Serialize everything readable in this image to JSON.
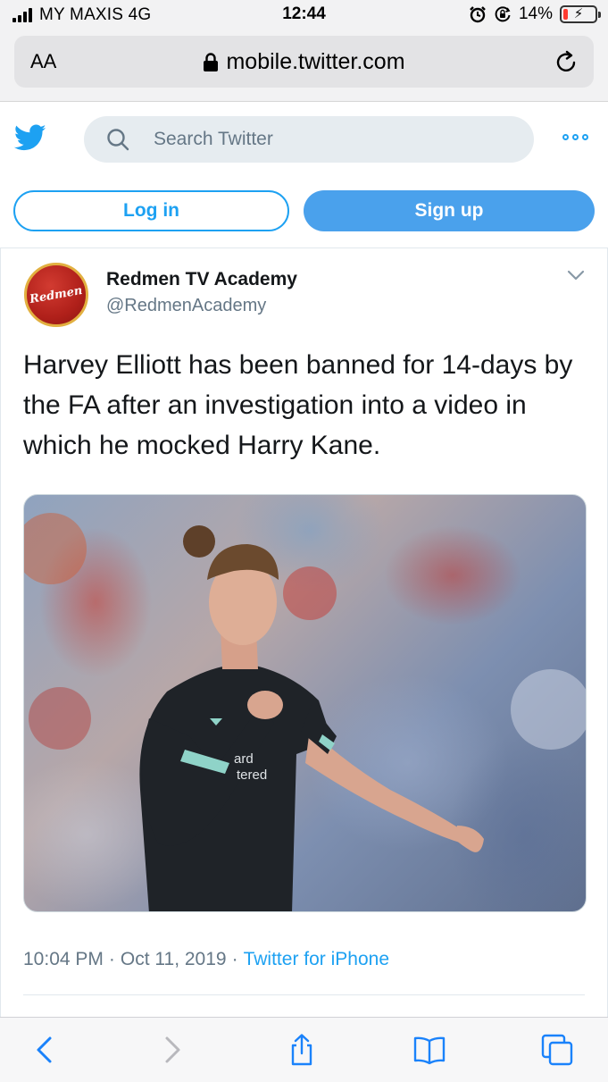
{
  "status_bar": {
    "carrier": "MY MAXIS 4G",
    "time": "12:44",
    "battery_percent": "14%",
    "battery_level": 0.14,
    "battery_color": "#ff3b30",
    "icons": [
      "signal-icon",
      "alarm-icon",
      "orientation-lock-icon",
      "battery-icon"
    ]
  },
  "browser": {
    "text_size_label": "AA",
    "url": "mobile.twitter.com",
    "icons": [
      "lock-icon",
      "reload-icon"
    ]
  },
  "twitter_nav": {
    "logo": "twitter-bird-icon",
    "search_placeholder": "Search Twitter",
    "login_label": "Log in",
    "signup_label": "Sign up",
    "accent_color": "#1da1f2"
  },
  "tweet": {
    "display_name": "Redmen TV Academy",
    "handle": "@RedmenAcademy",
    "avatar_text": "Redmen",
    "text": "Harvey Elliott has been banned for 14-days by the FA after an investigation into a video in which he mocked Harry Kane.",
    "time": "10:04 PM",
    "date": "Oct 11, 2019",
    "source": "Twitter for iPhone",
    "separator": "·"
  },
  "toolbar": {
    "icons": [
      "back-icon",
      "forward-icon",
      "share-icon",
      "bookmarks-icon",
      "tabs-icon"
    ]
  }
}
